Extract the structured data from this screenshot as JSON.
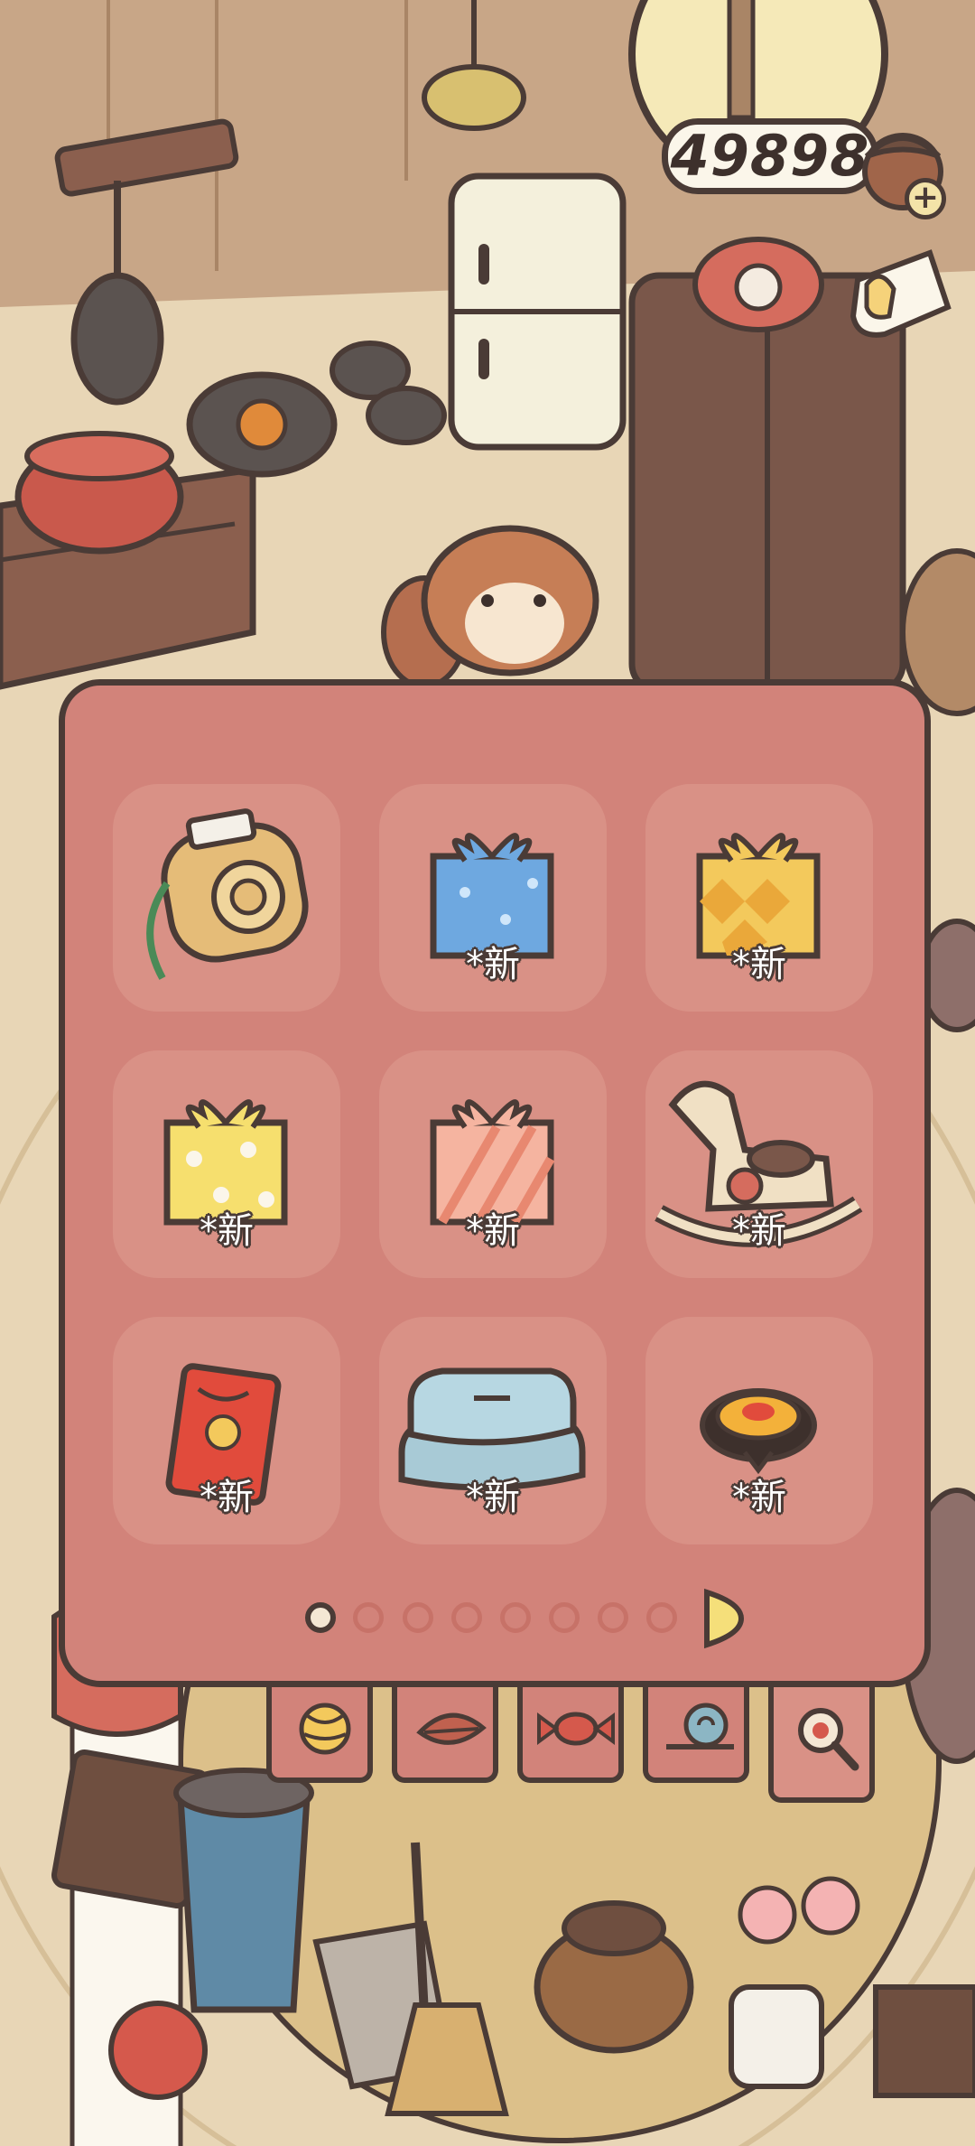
{
  "currency": {
    "amount": "49898",
    "icon": "acorn-icon",
    "add_icon": "plus-icon"
  },
  "header": {
    "guide_icon": "pointing-hand-icon"
  },
  "inventory": {
    "items": [
      {
        "name": "instant-camera",
        "badge": ""
      },
      {
        "name": "blue-gift-box",
        "badge": "*新"
      },
      {
        "name": "orange-checkered-gift-box",
        "badge": "*新"
      },
      {
        "name": "yellow-polka-dot-gift-box",
        "badge": "*新"
      },
      {
        "name": "pink-striped-gift-box",
        "badge": "*新"
      },
      {
        "name": "rocking-horse",
        "badge": "*新"
      },
      {
        "name": "red-envelope",
        "badge": "*新"
      },
      {
        "name": "folded-blue-clothes",
        "badge": "*新"
      },
      {
        "name": "spinning-top",
        "badge": "*新"
      }
    ],
    "pagination": {
      "total": 8,
      "current": 1
    }
  },
  "tabs": [
    {
      "name": "yarn-ball-icon",
      "selected": false
    },
    {
      "name": "leaf-icon",
      "selected": false
    },
    {
      "name": "candy-icon",
      "selected": false
    },
    {
      "name": "snail-icon",
      "selected": false
    },
    {
      "name": "magnifier-icon",
      "selected": true
    }
  ],
  "colors": {
    "panel": "#d2837a",
    "slot": "#d99186",
    "outline": "#4a3b36",
    "floor": "#e8d2b0"
  }
}
